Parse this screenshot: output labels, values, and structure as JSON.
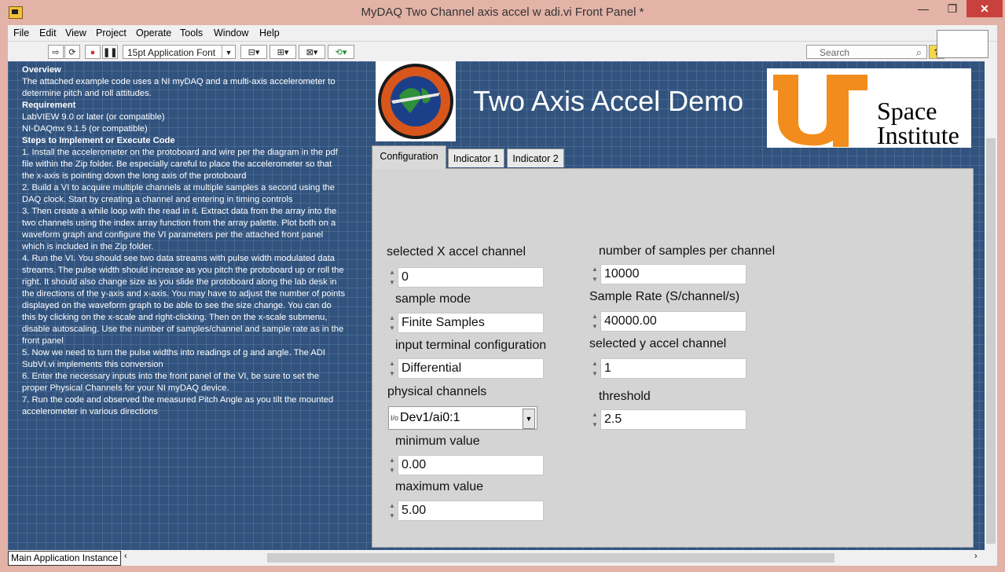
{
  "window": {
    "title": "MyDAQ Two Channel  axis accel w adi.vi Front Panel *",
    "min": "—",
    "max": "❐",
    "close": "✕"
  },
  "menu": [
    "File",
    "Edit",
    "View",
    "Project",
    "Operate",
    "Tools",
    "Window",
    "Help"
  ],
  "toolbar": {
    "font": "15pt Application Font",
    "search_placeholder": "Search",
    "help": "?"
  },
  "notes": [
    {
      "t": "Overview",
      "b": true
    },
    {
      "t": "The attached example code uses a NI myDAQ and a multi-axis accelerometer to determine pitch and roll attitudes."
    },
    {
      "t": "Requirement",
      "b": true
    },
    {
      "t": "LabVIEW 9.0 or later (or compatible)"
    },
    {
      "t": "NI-DAQmx 9.1.5 (or compatible)"
    },
    {
      "t": "Steps to Implement or Execute Code",
      "b": true
    },
    {
      "t": "1. Install the accelerometer on the protoboard and wire per the diagram in the pdf file within the Zip folder. Be especially careful to place the accelerometer so that the x-axis is pointing down the long axis of the protoboard"
    },
    {
      "t": "2. Build a VI to acquire multiple channels at multiple samples a second using the DAQ clock. Start by creating a channel and entering in timing controls"
    },
    {
      "t": "3. Then create a while loop with the read in it. Extract data from the array into the two channels using the index array function from the array palette. Plot both on a waveform graph and configure the VI parameters per the attached front panel which is included in the Zip folder."
    },
    {
      "t": "4. Run the VI. You should see two data streams with pulse width modulated data streams. The pulse width should increase as you pitch the protoboard up or roll the right. It should also change size as you slide the protoboard along the lab desk in the directions of the y-axis and x-axis. You may have to adjust the number of points displayed on the waveform graph to be able to see the size change. You can do this by clicking on the x-scale and right-clicking. Then on the x-scale submenu, disable autoscaling. Use the number of samples/channel and sample rate as in the front panel"
    },
    {
      "t": "5. Now we need to turn the pulse widths into readings of g and angle. The ADI SubVI.vi implements this conversion"
    },
    {
      "t": "6. Enter the necessary inputs into the front panel of the VI, be sure to set the proper Physical Channels for your NI myDAQ device."
    },
    {
      "t": "7. Run the code and observed the measured Pitch Angle as you tilt the mounted accelerometer in various directions"
    }
  ],
  "banner": {
    "title": "Two Axis Accel Demo",
    "logo_left": "aviation-systems-logo",
    "logo_right_line1": "Space",
    "logo_right_line2": "Institute"
  },
  "tabs": [
    "Configuration",
    "Indicator 1",
    "Indicator 2"
  ],
  "controls": {
    "x_channel": {
      "label": "selected X accel channel",
      "value": "0"
    },
    "sample_mode": {
      "label": "sample mode",
      "value": "Finite Samples"
    },
    "input_term": {
      "label": "input terminal configuration",
      "value": "Differential"
    },
    "phys_channels": {
      "label": "physical channels",
      "value": "Dev1/ai0:1",
      "prefix": "I/o"
    },
    "min_value": {
      "label": "minimum value",
      "value": "0.00"
    },
    "max_value": {
      "label": "maximum value",
      "value": "5.00"
    },
    "samples_per_channel": {
      "label": "number of samples per channel",
      "value": "10000"
    },
    "sample_rate": {
      "label": "Sample Rate (S/channel/s)",
      "value": "40000.00"
    },
    "y_channel": {
      "label": "selected y accel channel",
      "value": "1"
    },
    "threshold": {
      "label": "threshold",
      "value": "2.5"
    }
  },
  "status": {
    "instance": "Main Application Instance"
  }
}
